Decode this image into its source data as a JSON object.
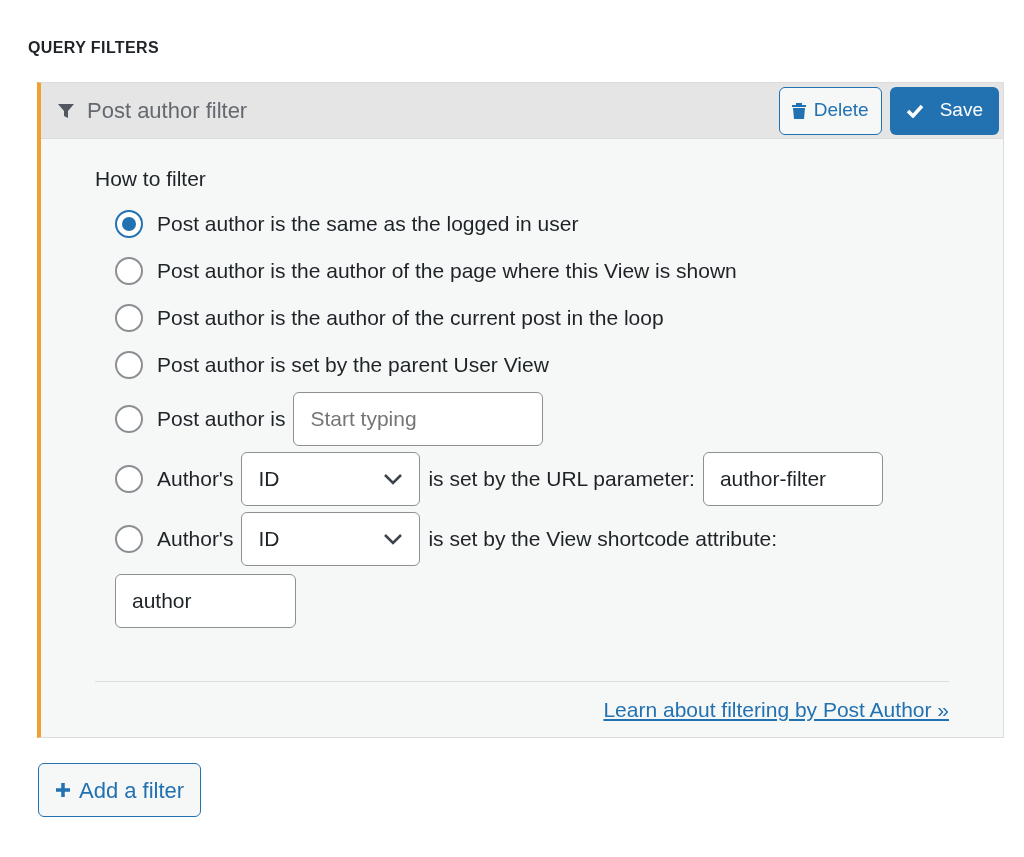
{
  "section_title": "QUERY FILTERS",
  "filter": {
    "title": "Post author filter",
    "delete_label": "Delete",
    "save_label": "Save",
    "heading": "How to filter",
    "options": [
      {
        "selected": true,
        "parts": [
          {
            "kind": "text",
            "text": "Post author is the same as the logged in user"
          }
        ]
      },
      {
        "selected": false,
        "parts": [
          {
            "kind": "text",
            "text": "Post author is the author of the page where this View is shown"
          }
        ]
      },
      {
        "selected": false,
        "parts": [
          {
            "kind": "text",
            "text": "Post author is the author of the current post in the loop"
          }
        ]
      },
      {
        "selected": false,
        "parts": [
          {
            "kind": "text",
            "text": "Post author is set by the parent User View"
          }
        ]
      },
      {
        "selected": false,
        "parts": [
          {
            "kind": "text",
            "text": "Post author is"
          },
          {
            "kind": "field",
            "placeholder": "Start typing"
          }
        ]
      },
      {
        "selected": false,
        "parts": [
          {
            "kind": "text",
            "text": "Author's"
          },
          {
            "kind": "select",
            "value": "ID"
          },
          {
            "kind": "text",
            "text": "is set by the URL parameter:"
          },
          {
            "kind": "field",
            "value": "author-filter"
          }
        ]
      },
      {
        "selected": false,
        "parts": [
          {
            "kind": "text",
            "text": "Author's"
          },
          {
            "kind": "select",
            "value": "ID"
          },
          {
            "kind": "text",
            "text": "is set by the View shortcode attribute:"
          },
          {
            "kind": "field",
            "value": "author"
          }
        ]
      }
    ],
    "link": "Learn about filtering by Post Author »"
  },
  "add_button": "Add a filter"
}
